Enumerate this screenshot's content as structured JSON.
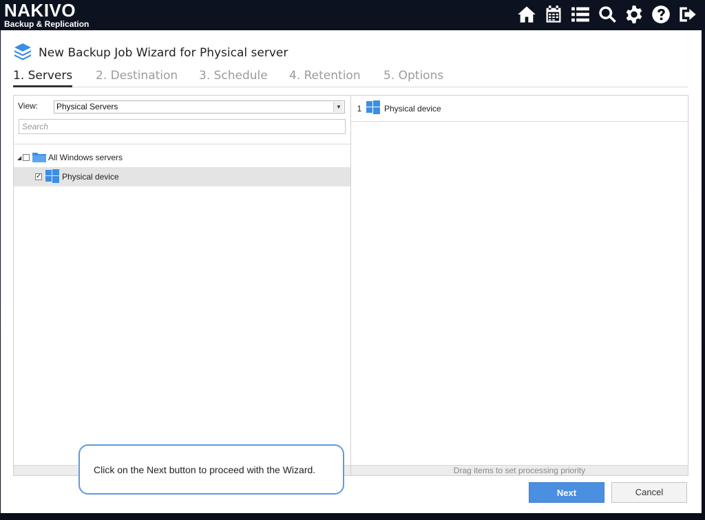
{
  "app": {
    "brand": "NAKIVO",
    "brand_sub": "Backup & Replication"
  },
  "top_icons": [
    "home-icon",
    "calendar-icon",
    "list-icon",
    "search-icon",
    "gear-icon",
    "help-icon",
    "logout-icon"
  ],
  "dialog": {
    "title": "New Backup Job Wizard for Physical server",
    "steps": [
      {
        "label": "1. Servers",
        "active": true
      },
      {
        "label": "2. Destination",
        "active": false
      },
      {
        "label": "3. Schedule",
        "active": false
      },
      {
        "label": "4. Retention",
        "active": false
      },
      {
        "label": "5. Options",
        "active": false
      }
    ]
  },
  "left_panel": {
    "view_label": "View:",
    "view_value": "Physical Servers",
    "search_placeholder": "Search",
    "tree": [
      {
        "label": "All Windows servers",
        "checked": false,
        "expanded": true
      },
      {
        "label": "Physical device",
        "checked": true,
        "selected": true
      }
    ]
  },
  "right_panel": {
    "selected_items": [
      {
        "index": "1",
        "label": "Physical device"
      }
    ],
    "footer_hint": "Drag items to set processing priority"
  },
  "tooltip": {
    "text": "Click on the Next button to proceed with the Wizard."
  },
  "buttons": {
    "next": "Next",
    "cancel": "Cancel"
  },
  "colors": {
    "accent": "#4a8fe0",
    "windows_blue": "#3b8ee6",
    "tooltip_border": "#5b9be0"
  }
}
